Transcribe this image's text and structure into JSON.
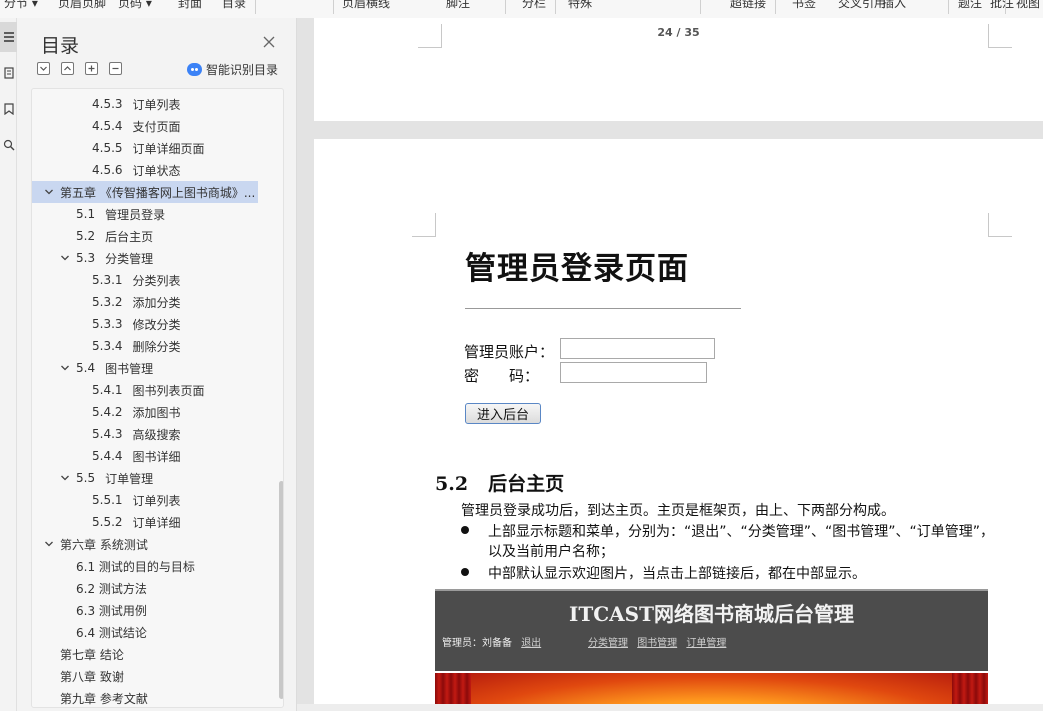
{
  "toolbar": {
    "items": [
      "分节 ▾",
      "页眉页脚",
      "页码 ▾",
      "封面",
      "目录",
      "页眉横线",
      "脚注",
      "分栏",
      "特殊",
      "超链接",
      "书签",
      "交叉引用",
      "插入",
      "题注",
      "批注",
      "视图"
    ]
  },
  "rail": {
    "icons": [
      "toc-list-icon",
      "page-thumbnail-icon",
      "bookmark-icon",
      "find-icon"
    ]
  },
  "toc": {
    "title": "目录",
    "smart_label": "智能识别目录",
    "items": [
      {
        "num": "4.5.3",
        "text": "订单列表",
        "level": 3,
        "expanded": null,
        "selected": false
      },
      {
        "num": "4.5.4",
        "text": "支付页面",
        "level": 3,
        "expanded": null,
        "selected": false
      },
      {
        "num": "4.5.5",
        "text": "订单详细页面",
        "level": 3,
        "expanded": null,
        "selected": false
      },
      {
        "num": "4.5.6",
        "text": "订单状态",
        "level": 3,
        "expanded": null,
        "selected": false
      },
      {
        "num": "",
        "text": "第五章 《传智播客网上图书商城》...",
        "level": 1,
        "expanded": true,
        "selected": true
      },
      {
        "num": "5.1",
        "text": "管理员登录",
        "level": 2,
        "expanded": null,
        "selected": false
      },
      {
        "num": "5.2",
        "text": "后台主页",
        "level": 2,
        "expanded": null,
        "selected": false
      },
      {
        "num": "5.3",
        "text": "分类管理",
        "level": 2,
        "expanded": true,
        "selected": false
      },
      {
        "num": "5.3.1",
        "text": "分类列表",
        "level": 3,
        "expanded": null,
        "selected": false
      },
      {
        "num": "5.3.2",
        "text": "添加分类",
        "level": 3,
        "expanded": null,
        "selected": false
      },
      {
        "num": "5.3.3",
        "text": "修改分类",
        "level": 3,
        "expanded": null,
        "selected": false
      },
      {
        "num": "5.3.4",
        "text": "删除分类",
        "level": 3,
        "expanded": null,
        "selected": false
      },
      {
        "num": "5.4",
        "text": "图书管理",
        "level": 2,
        "expanded": true,
        "selected": false
      },
      {
        "num": "5.4.1",
        "text": "图书列表页面",
        "level": 3,
        "expanded": null,
        "selected": false
      },
      {
        "num": "5.4.2",
        "text": "添加图书",
        "level": 3,
        "expanded": null,
        "selected": false
      },
      {
        "num": "5.4.3",
        "text": "高级搜索",
        "level": 3,
        "expanded": null,
        "selected": false
      },
      {
        "num": "5.4.4",
        "text": "图书详细",
        "level": 3,
        "expanded": null,
        "selected": false
      },
      {
        "num": "5.5",
        "text": "订单管理",
        "level": 2,
        "expanded": true,
        "selected": false
      },
      {
        "num": "5.5.1",
        "text": "订单列表",
        "level": 3,
        "expanded": null,
        "selected": false
      },
      {
        "num": "5.5.2",
        "text": "订单详细",
        "level": 3,
        "expanded": null,
        "selected": false
      },
      {
        "num": "",
        "text": "第六章 系统测试",
        "level": 1,
        "expanded": true,
        "selected": false
      },
      {
        "num": "",
        "text": "6.1 测试的目的与目标",
        "level": 2,
        "expanded": null,
        "selected": false
      },
      {
        "num": "",
        "text": "6.2 测试方法",
        "level": 2,
        "expanded": null,
        "selected": false
      },
      {
        "num": "",
        "text": "6.3 测试用例",
        "level": 2,
        "expanded": null,
        "selected": false
      },
      {
        "num": "",
        "text": "6.4 测试结论",
        "level": 2,
        "expanded": null,
        "selected": false
      },
      {
        "num": "",
        "text": "第七章 结论",
        "level": 1,
        "expanded": null,
        "selected": false
      },
      {
        "num": "",
        "text": "第八章 致谢",
        "level": 1,
        "expanded": null,
        "selected": false
      },
      {
        "num": "",
        "text": "第九章 参考文献",
        "level": 1,
        "expanded": null,
        "selected": false
      }
    ]
  },
  "document": {
    "page_number": "24 / 35",
    "login_heading": "管理员登录页面",
    "account_label": "管理员账户：",
    "password_label": "密　　码：",
    "enter_button": "进入后台",
    "section_num": "5.2",
    "section_title": "后台主页",
    "intro": "管理员登录成功后，到达主页。主页是框架页，由上、下两部分构成。",
    "bullet1_line1": "上部显示标题和菜单，分别为：“退出”、“分类管理”、“图书管理”、“订单管理”，",
    "bullet1_line2": "以及当前用户名称；",
    "bullet2": "中部默认显示欢迎图片，当点击上部链接后，都在中部显示。"
  },
  "embedded": {
    "title": "ITCAST网络图书商城后台管理",
    "user_prefix": "管理员：刘备备",
    "logout": "退出",
    "menu": [
      "分类管理",
      "图书管理",
      "订单管理"
    ]
  },
  "colors": {
    "selected_row": "#c9d7f0",
    "embedded_header": "#4c4c4c"
  }
}
